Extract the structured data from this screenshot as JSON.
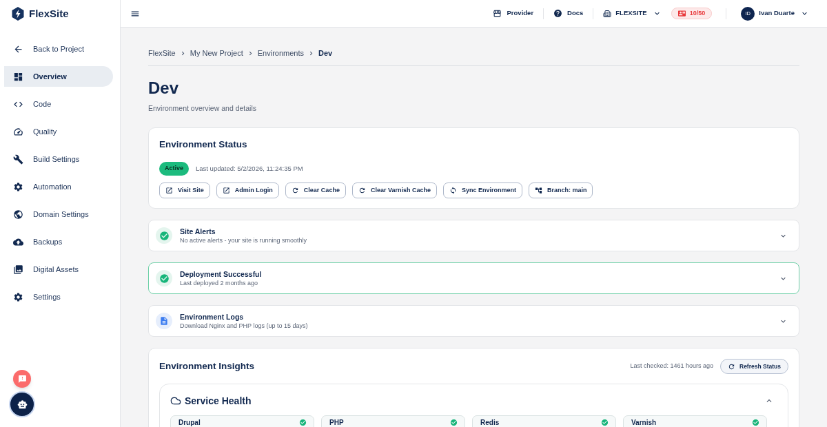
{
  "sidebar": {
    "logo": "FlexSite",
    "back_link": "Back to Project",
    "items": [
      {
        "label": "Overview",
        "selected": true
      },
      {
        "label": "Code",
        "selected": false
      },
      {
        "label": "Quality",
        "selected": false
      },
      {
        "label": "Build Settings",
        "selected": false
      },
      {
        "label": "Automation",
        "selected": false
      },
      {
        "label": "Domain Settings",
        "selected": false
      },
      {
        "label": "Backups",
        "selected": false
      },
      {
        "label": "Digital Assets",
        "selected": false
      },
      {
        "label": "Settings",
        "selected": false
      }
    ]
  },
  "header": {
    "provider": "Provider",
    "docs": "Docs",
    "organization": "FLEXSITE",
    "usage": "10/50",
    "user": {
      "initials": "ID",
      "name": "Ivan Duarte"
    }
  },
  "breadcrumb": [
    "FlexSite",
    "My New Project",
    "Environments",
    "Dev"
  ],
  "page": {
    "title": "Dev",
    "subtitle": "Environment overview and details"
  },
  "status_card": {
    "title": "Environment Status",
    "status": "Active",
    "last_updated": "Last updated: 5/2/2026, 11:24:35 PM",
    "actions": [
      {
        "label": "Visit Site",
        "kind": "external"
      },
      {
        "label": "Admin Login",
        "kind": "external"
      },
      {
        "label": "Clear Cache",
        "kind": "refresh"
      },
      {
        "label": "Clear Varnish Cache",
        "kind": "refresh"
      },
      {
        "label": "Sync Environment",
        "kind": "sync"
      },
      {
        "label": "Branch: main",
        "kind": "branch"
      }
    ]
  },
  "panels": [
    {
      "kind": "success",
      "title": "Site Alerts",
      "description": "No active alerts - your site is running smoothly",
      "highlighted": false,
      "expanded": false
    },
    {
      "kind": "success",
      "title": "Deployment Successful",
      "description": "Last deployed 2 months ago",
      "highlighted": true,
      "expanded": false
    },
    {
      "kind": "document",
      "title": "Environment Logs",
      "description": "Download Nginx and PHP logs (up to 15 days)",
      "highlighted": false,
      "expanded": false
    }
  ],
  "insights": {
    "title": "Environment Insights",
    "last_checked": "Last checked: 1461 hours ago",
    "refresh_button": "Refresh Status",
    "service_health": {
      "title": "Service Health",
      "expanded": true,
      "services": [
        {
          "name": "Drupal",
          "healthy": true
        },
        {
          "name": "PHP",
          "healthy": true
        },
        {
          "name": "Redis",
          "healthy": true
        },
        {
          "name": "Varnish",
          "healthy": true
        }
      ]
    }
  }
}
